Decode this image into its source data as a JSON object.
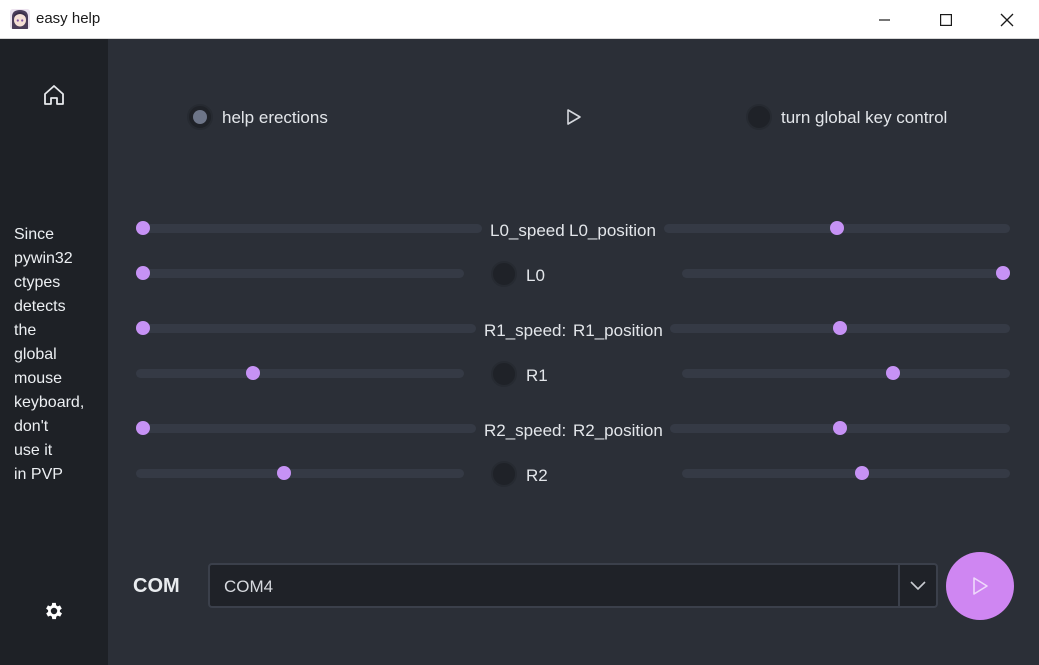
{
  "window": {
    "title": "easy help",
    "icon": "anime-avatar-icon",
    "controls": [
      "minimize-icon",
      "maximize-icon",
      "close-icon"
    ]
  },
  "sidebar": {
    "home_icon": "home-icon",
    "settings_icon": "gear-icon",
    "warning_lines": [
      "Since",
      "pywin32",
      "ctypes",
      "detects",
      "the",
      "global",
      "mouse",
      "keyboard,",
      "don't",
      "use it",
      "in PVP"
    ]
  },
  "toggles": {
    "help_erections": {
      "label": "help erections",
      "checked": true
    },
    "play_icon": "play-icon",
    "global_key_control": {
      "label": "turn global key control",
      "checked": false
    }
  },
  "sliders": {
    "L0_speed": {
      "label": "L0_speed",
      "value": 0.0
    },
    "L0_position": {
      "label": "L0_position",
      "value": 0.5
    },
    "L0_left2": {
      "value": 0.0
    },
    "L0_toggle": {
      "label": "L0",
      "checked": false
    },
    "L0_right2": {
      "value": 1.0
    },
    "R1_speed": {
      "label": "R1_speed:",
      "value": 0.0
    },
    "R1_position": {
      "label": "R1_position",
      "value": 0.5
    },
    "R1_left2": {
      "value": 0.35
    },
    "R1_toggle": {
      "label": "R1",
      "checked": false
    },
    "R1_right2": {
      "value": 0.65
    },
    "R2_speed": {
      "label": "R2_speed:",
      "value": 0.0
    },
    "R2_position": {
      "label": "R2_position",
      "value": 0.5
    },
    "R2_left2": {
      "value": 0.45
    },
    "R2_toggle": {
      "label": "R2",
      "checked": false
    },
    "R2_right2": {
      "value": 0.55
    }
  },
  "com": {
    "label": "COM",
    "selected": "COM4",
    "dropdown_icon": "chevron-down-icon",
    "run_icon": "play-icon"
  },
  "colors": {
    "accent": "#c692f5",
    "run_button": "#cf86f2",
    "main_bg": "#2b2f37",
    "sidebar_bg": "#1e2126",
    "track": "#353a45"
  }
}
